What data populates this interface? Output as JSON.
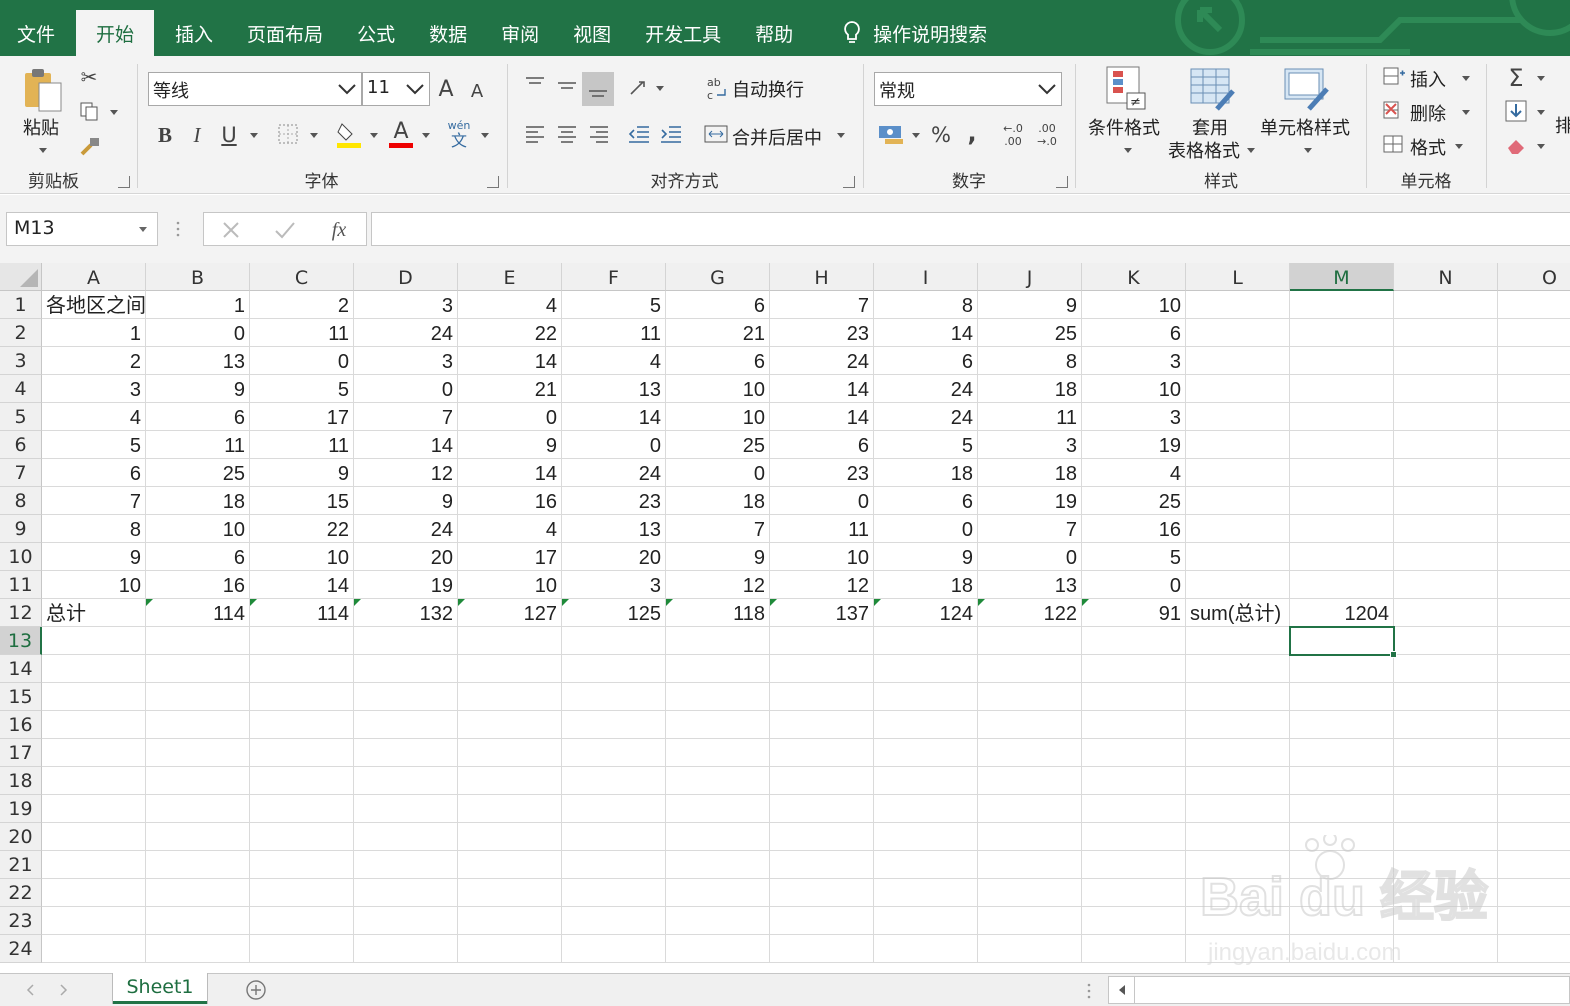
{
  "menu": {
    "tabs": [
      "文件",
      "开始",
      "插入",
      "页面布局",
      "公式",
      "数据",
      "审阅",
      "视图",
      "开发工具",
      "帮助"
    ],
    "active_tab": "开始",
    "tell_me": "操作说明搜索"
  },
  "ribbon": {
    "clipboard": {
      "group_label": "剪贴板",
      "paste_label": "粘贴"
    },
    "font": {
      "group_label": "字体",
      "font_name": "等线",
      "font_size": "11",
      "bold": "B",
      "italic": "I",
      "underline": "U",
      "phonetic_top": "wén",
      "phonetic_bottom": "文",
      "grow": "A",
      "shrink": "A",
      "font_color_letter": "A"
    },
    "alignment": {
      "group_label": "对齐方式",
      "wrap_text": "自动换行",
      "merge_center": "合并后居中"
    },
    "number": {
      "group_label": "数字",
      "format": "常规",
      "percent": "%",
      "comma": ",",
      "inc_decimal_top": "←.0",
      "inc_decimal_bottom": ".00",
      "dec_decimal_top": ".00",
      "dec_decimal_bottom": "→.0"
    },
    "styles": {
      "group_label": "样式",
      "conditional": "条件格式",
      "table_format_1": "套用",
      "table_format_2": "表格格式",
      "cell_styles": "单元格样式"
    },
    "cells": {
      "group_label": "单元格",
      "insert": "插入",
      "delete": "删除",
      "format": "格式"
    },
    "editing": {
      "sum_symbol": "Σ",
      "sort_partial": "排"
    }
  },
  "formula_bar": {
    "name_box": "M13",
    "fx": "fx",
    "formula": ""
  },
  "columns": [
    "A",
    "B",
    "C",
    "D",
    "E",
    "F",
    "G",
    "H",
    "I",
    "J",
    "K",
    "L",
    "M",
    "N",
    "O"
  ],
  "rows": [
    "1",
    "2",
    "3",
    "4",
    "5",
    "6",
    "7",
    "8",
    "9",
    "10",
    "11",
    "12",
    "13",
    "14",
    "15",
    "16",
    "17",
    "18",
    "19",
    "20",
    "21",
    "22",
    "23",
    "24"
  ],
  "selected_cell": {
    "column": "M",
    "row": "13"
  },
  "cells": {
    "r1": [
      "各地区之间",
      "1",
      "2",
      "3",
      "4",
      "5",
      "6",
      "7",
      "8",
      "9",
      "10"
    ],
    "r2": [
      "1",
      "0",
      "11",
      "24",
      "22",
      "11",
      "21",
      "23",
      "14",
      "25",
      "6"
    ],
    "r3": [
      "2",
      "13",
      "0",
      "3",
      "14",
      "4",
      "6",
      "24",
      "6",
      "8",
      "3"
    ],
    "r4": [
      "3",
      "9",
      "5",
      "0",
      "21",
      "13",
      "10",
      "14",
      "24",
      "18",
      "10"
    ],
    "r5": [
      "4",
      "6",
      "17",
      "7",
      "0",
      "14",
      "10",
      "14",
      "24",
      "11",
      "3"
    ],
    "r6": [
      "5",
      "11",
      "11",
      "14",
      "9",
      "0",
      "25",
      "6",
      "5",
      "3",
      "19"
    ],
    "r7": [
      "6",
      "25",
      "9",
      "12",
      "14",
      "24",
      "0",
      "23",
      "18",
      "18",
      "4"
    ],
    "r8": [
      "7",
      "18",
      "15",
      "9",
      "16",
      "23",
      "18",
      "0",
      "6",
      "19",
      "25"
    ],
    "r9": [
      "8",
      "10",
      "22",
      "24",
      "4",
      "13",
      "7",
      "11",
      "0",
      "7",
      "16"
    ],
    "r10": [
      "9",
      "6",
      "10",
      "20",
      "17",
      "20",
      "9",
      "10",
      "9",
      "0",
      "5"
    ],
    "r11": [
      "10",
      "16",
      "14",
      "19",
      "10",
      "3",
      "12",
      "12",
      "18",
      "13",
      "0"
    ],
    "r12": [
      "总计",
      "114",
      "114",
      "132",
      "127",
      "125",
      "118",
      "137",
      "124",
      "122",
      "91",
      "sum(总计)",
      "1204"
    ]
  },
  "sheet_tabs": [
    "Sheet1"
  ],
  "watermark": {
    "brand": "Bai du 经验",
    "url": "jingyan.baidu.com"
  },
  "colors": {
    "brand_green": "#217346",
    "ribbon_bg": "#f3f3f3",
    "flag_green": "#1f8a3a"
  }
}
